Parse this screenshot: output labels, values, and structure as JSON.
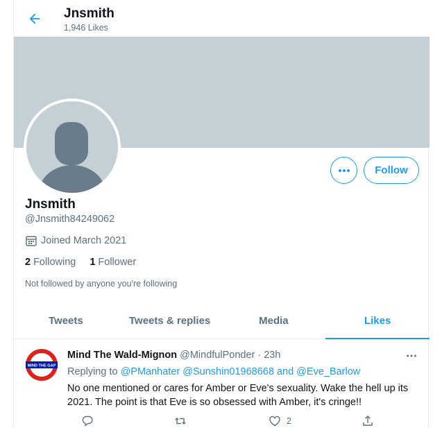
{
  "header": {
    "title": "Jnsmith",
    "subtitle": "1,946 Likes"
  },
  "colors": {
    "accent": "#1d9bf0",
    "banner": "#c4cfd6",
    "avatar_figure": "#6a7c8c",
    "muted_text": "#5b7083"
  },
  "icons": {
    "back": "arrow-left-icon",
    "more": "more-horizontal-icon",
    "calendar": "calendar-icon",
    "reply": "reply-icon",
    "retweet": "retweet-icon",
    "like": "heart-icon",
    "share": "share-icon"
  },
  "profile": {
    "name": "Jnsmith",
    "handle": "@Jnsmith84249062",
    "joined": "Joined March 2021",
    "following_count": "2",
    "following_label": "Following",
    "followers_count": "1",
    "followers_label": "Follower",
    "not_followed": "Not followed by anyone you're following",
    "follow_button": "Follow"
  },
  "tabs": [
    {
      "label": "Tweets",
      "active": false
    },
    {
      "label": "Tweets & replies",
      "active": false
    },
    {
      "label": "Media",
      "active": false
    },
    {
      "label": "Likes",
      "active": true
    }
  ],
  "tweet": {
    "author_name": "Mind The Wald-Mignon",
    "author_handle": "@MindfulPonder",
    "separator": "·",
    "time": "23h",
    "avatar_text": "MIND THE GAP",
    "replying_to_label": "Replying to",
    "mention_1": "@PManhater",
    "mention_2": "@Sunshin01968668",
    "and_label": "and",
    "mention_3": "@Eve_Barlow",
    "text": "No one mentioned or cares for Amber or Eve's sexuality. Wake the hell up its 2021. The point is that Eve is so obsessed with Amber, it's cringe!!",
    "like_count": "2"
  }
}
